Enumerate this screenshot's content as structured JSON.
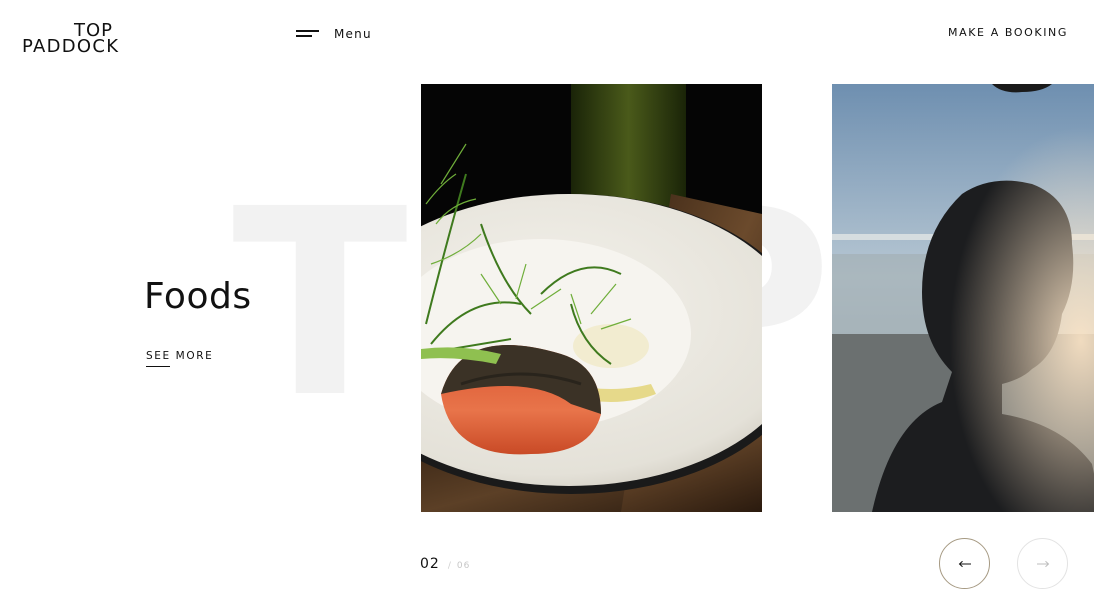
{
  "header": {
    "logo_line1": "TOP",
    "logo_line2": "PADDOCK",
    "menu_label": "Menu",
    "booking_label": "MAKE A BOOKING"
  },
  "hero": {
    "background_letters": "TOP",
    "title": "Foods",
    "see_more_label": "SEE MORE"
  },
  "slider": {
    "current": "02",
    "separator": "/",
    "total": "06",
    "prev_icon": "arrow-left-icon",
    "next_icon": "arrow-right-icon"
  },
  "colors": {
    "text": "#111111",
    "background_letters": "#f2f2f2",
    "prev_border": "#a69a83",
    "next_border": "#e3e3e3",
    "counter_muted": "#c6c6c6"
  }
}
